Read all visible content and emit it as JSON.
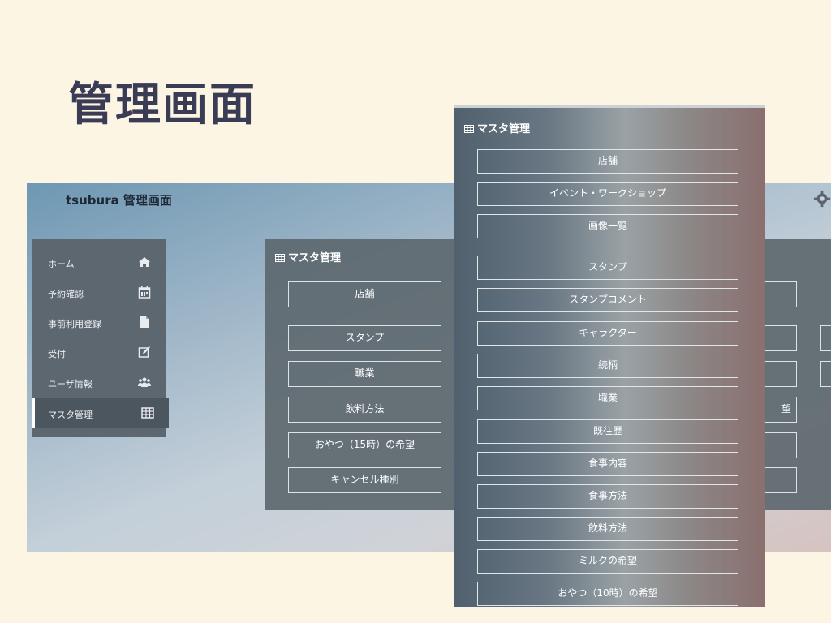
{
  "slide_title": "管理画面",
  "app": {
    "title": "tsubura 管理画面",
    "settings_icon": "gear-icon"
  },
  "sidebar": {
    "items": [
      {
        "label": "ホーム",
        "icon": "home-icon"
      },
      {
        "label": "予約確認",
        "icon": "calendar-icon"
      },
      {
        "label": "事前利用登録",
        "icon": "file-icon"
      },
      {
        "label": "受付",
        "icon": "edit-icon"
      },
      {
        "label": "ユーザ情報",
        "icon": "users-icon"
      },
      {
        "label": "マスタ管理",
        "icon": "table-icon",
        "active": true
      }
    ]
  },
  "master_panel": {
    "title": "マスタ管理",
    "top_buttons": [
      "店舗"
    ],
    "buttons": [
      "スタンプ",
      "職業",
      "飲料方法",
      "おやつ（15時）の希望",
      "キャンセル種別"
    ]
  },
  "right_panel_partial": {
    "visible_label": "望"
  },
  "zoom_panel": {
    "title": "マスタ管理",
    "top_buttons": [
      "店舗",
      "イベント・ワークショップ",
      "画像一覧"
    ],
    "buttons": [
      "スタンプ",
      "スタンプコメント",
      "キャラクター",
      "続柄",
      "職業",
      "既往歴",
      "食事内容",
      "食事方法",
      "飲料方法",
      "ミルクの希望",
      "おやつ（10時）の希望"
    ]
  }
}
